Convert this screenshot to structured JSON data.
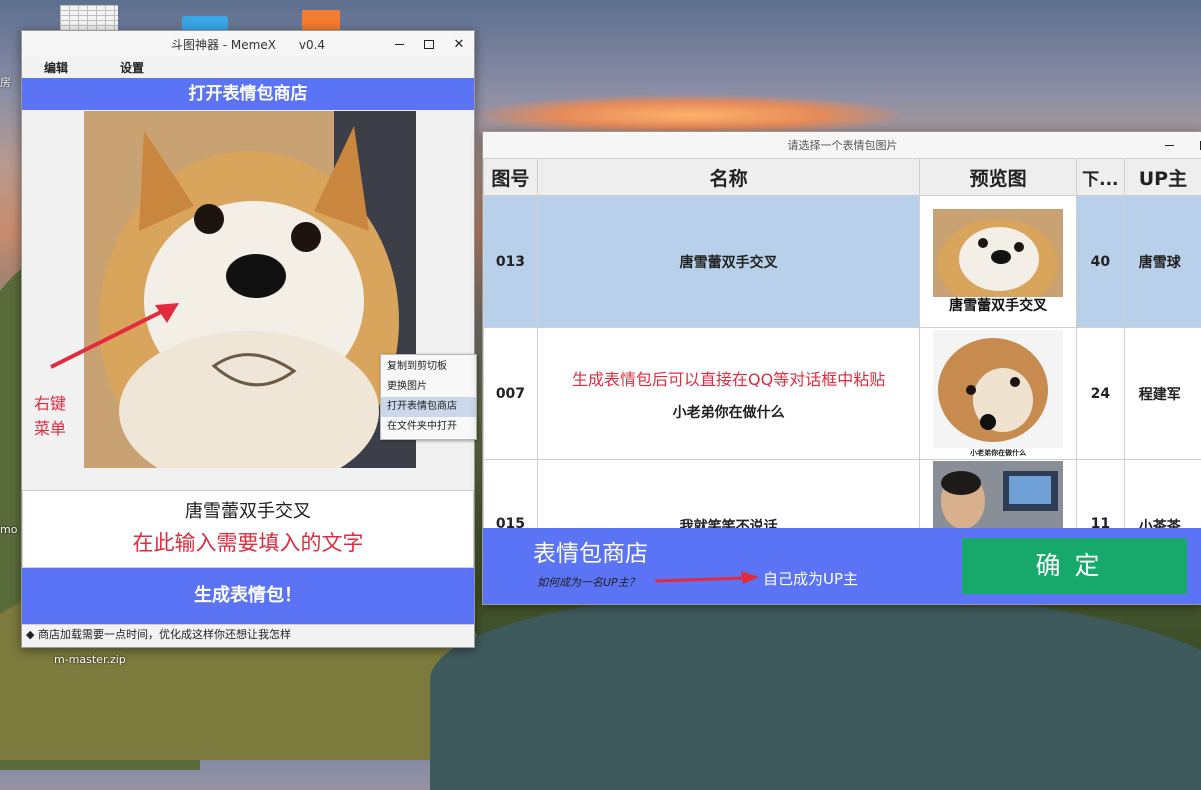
{
  "desktop": {
    "labels": {
      "left_edge": "房",
      "mo": "mo",
      "zip": "m-master.zip"
    }
  },
  "left_window": {
    "title": "斗图神器 - MemeX      v0.4",
    "menu": [
      "编辑",
      "设置"
    ],
    "open_shop_label": "打开表情包商店",
    "context_menu": [
      "复制到剪切板",
      "更换图片",
      "打开表情包商店",
      "在文件夹中打开"
    ],
    "context_highlight_index": 2,
    "annotation_line1": "右键",
    "annotation_line2": "菜单",
    "caption_text": "唐雪蕾双手交叉",
    "input_hint": "在此输入需要填入的文字",
    "generate_label": "生成表情包！",
    "status_text": "◆ 商店加载需要一点时间，优化成这样你还想让我怎样"
  },
  "right_window": {
    "title": "请选择一个表情包图片",
    "columns": [
      "图号",
      "名称",
      "预览图",
      "下...",
      "UP主"
    ],
    "rows": [
      {
        "id": "013",
        "name": "唐雪蕾双手交叉",
        "note": "",
        "thumb_caption": "唐雪蕾双手交叉",
        "downloads": "40",
        "up": "唐雪球",
        "selected": true
      },
      {
        "id": "007",
        "name": "小老弟你在做什么",
        "note": "生成表情包后可以直接在QQ等对话框中粘贴",
        "thumb_caption": "小老弟你在做什么",
        "downloads": "24",
        "up": "程建军",
        "selected": false
      },
      {
        "id": "015",
        "name": "我就笑笑不说话",
        "note": "",
        "thumb_caption": "",
        "downloads": "11",
        "up": "小茶茶",
        "selected": false
      }
    ],
    "shop_title": "表情包商店",
    "howto_link": "如何成为一名UP主？",
    "annotation": "自己成为UP主",
    "confirm_label": "确定"
  },
  "colors": {
    "accent_blue": "#5b73f5",
    "confirm_green": "#17a86b",
    "annotation_red": "#e12c3f",
    "selected_row": "#b9d0ea"
  }
}
